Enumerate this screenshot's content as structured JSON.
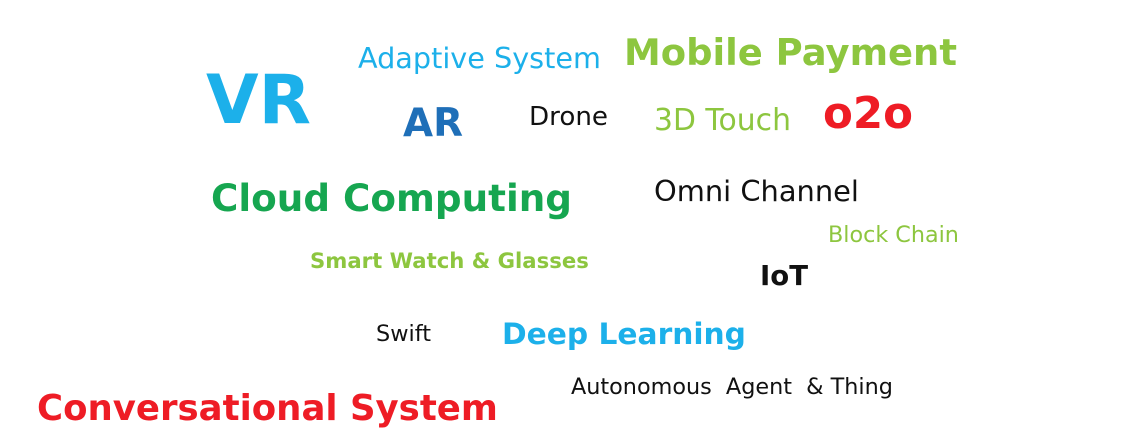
{
  "words": [
    {
      "key": "vr",
      "text": "VR",
      "color": "#1cb0ea",
      "weight": "bold"
    },
    {
      "key": "adaptive-system",
      "text": "Adaptive System",
      "color": "#1cb0ea",
      "weight": "normal"
    },
    {
      "key": "mobile-payment",
      "text": "Mobile Payment",
      "color": "#8dc63f",
      "weight": "bold"
    },
    {
      "key": "ar",
      "text": "AR",
      "color": "#1f6fb8",
      "weight": "bold"
    },
    {
      "key": "drone",
      "text": "Drone",
      "color": "#111111",
      "weight": "normal"
    },
    {
      "key": "3d-touch",
      "text": "3D Touch",
      "color": "#8dc63f",
      "weight": "normal"
    },
    {
      "key": "o2o",
      "text": "o2o",
      "color": "#ee1c25",
      "weight": "bold"
    },
    {
      "key": "cloud-computing",
      "text": "Cloud Computing",
      "color": "#16a650",
      "weight": "bold"
    },
    {
      "key": "omni-channel",
      "text": "Omni Channel",
      "color": "#111111",
      "weight": "normal"
    },
    {
      "key": "block-chain",
      "text": "Block Chain",
      "color": "#8dc63f",
      "weight": "normal"
    },
    {
      "key": "smart-watch-glasses",
      "text": "Smart Watch & Glasses",
      "color": "#8dc63f",
      "weight": "bold"
    },
    {
      "key": "iot",
      "text": "IoT",
      "color": "#111111",
      "weight": "bold"
    },
    {
      "key": "swift",
      "text": "Swift",
      "color": "#111111",
      "weight": "normal"
    },
    {
      "key": "deep-learning",
      "text": "Deep Learning",
      "color": "#1cb0ea",
      "weight": "bold"
    },
    {
      "key": "autonomous-agent-thing",
      "text": "Autonomous  Agent  & Thing",
      "color": "#111111",
      "weight": "normal"
    },
    {
      "key": "conversational-system",
      "text": "Conversational System",
      "color": "#ee1c25",
      "weight": "bold"
    }
  ]
}
